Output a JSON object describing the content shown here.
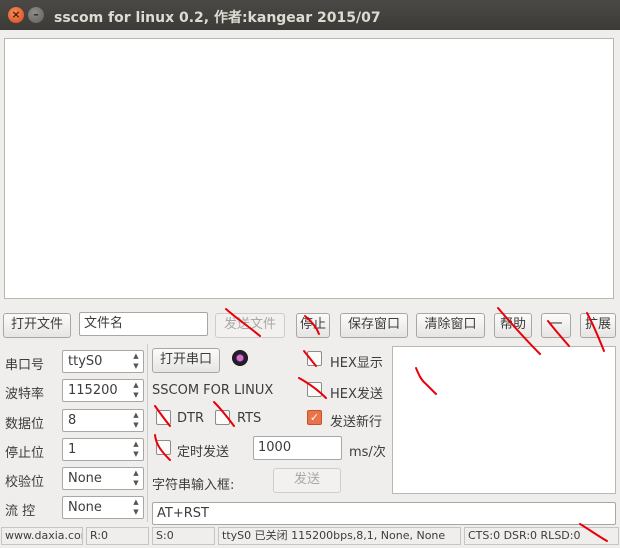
{
  "window": {
    "title": "sscom for linux 0.2, 作者:kangear 2015/07",
    "close_glyph": "×",
    "minimize_glyph": "–"
  },
  "toolbar": {
    "open_file": "打开文件",
    "filename": "文件名",
    "send_file": "发送文件",
    "stop": "停止",
    "save_window": "保存窗口",
    "clear_window": "清除窗口",
    "help": "帮助",
    "dash": "一",
    "expand": "扩展"
  },
  "serial": {
    "port_label": "串口号",
    "port_value": "ttyS0",
    "baud_label": "波特率",
    "baud_value": "115200",
    "databits_label": "数据位",
    "databits_value": "8",
    "stopbits_label": "停止位",
    "stopbits_value": "1",
    "parity_label": "校验位",
    "parity_value": "None",
    "flow_label": "流  控",
    "flow_value": "None"
  },
  "controls": {
    "open_port": "打开串口",
    "brand": "SSCOM FOR LINUX",
    "dtr": "DTR",
    "rts": "RTS",
    "timed_send": "定时发送",
    "interval_value": "1000",
    "interval_unit": "ms/次",
    "input_label": "字符串输入框:",
    "send": "发送",
    "hex_display": "HEX显示",
    "hex_send": "HEX发送",
    "send_newline": "发送新行",
    "send_newline_checked": true,
    "input_value": "AT+RST"
  },
  "statusbar": {
    "site": "www.daxia.com",
    "r": "R:0",
    "s": "S:0",
    "port_status": "ttyS0 已关闭 115200bps,8,1, None, None",
    "signals": "CTS:0  DSR:0  RLSD:0"
  },
  "colors": {
    "annotation": "#e8000b",
    "accent": "#e9744a"
  }
}
